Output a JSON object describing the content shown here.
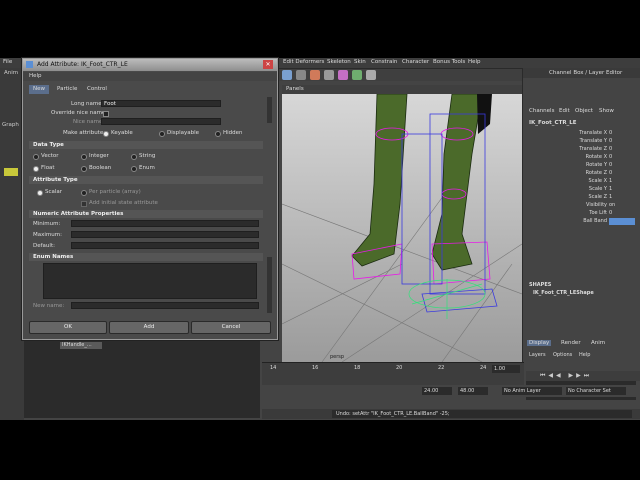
{
  "menubar": {
    "file": "File",
    "items": [
      "Edit Deformers",
      "Skeleton",
      "Skin",
      "Constrain",
      "Character",
      "Bonus Tools",
      "Help"
    ]
  },
  "left_panel": {
    "anim": "Anim",
    "graph": "Graph"
  },
  "viewport": {
    "panels": "Panels",
    "camera_label": "persp"
  },
  "timeline": {
    "ticks": [
      "14",
      "16",
      "18",
      "20",
      "22",
      "24"
    ],
    "current": "1.00"
  },
  "range": {
    "start": "24.00",
    "end": "48.00",
    "anim_layer": "No Anim Layer",
    "char_set": "No Character Set"
  },
  "command": {
    "text": "Undo: setAttr \"IK_Foot_CTR_LE.BallBand\" -25;"
  },
  "channel_box": {
    "header": "Channel Box / Layer Editor",
    "menu": [
      "Channels",
      "Edit",
      "Object",
      "Show"
    ],
    "node": "IK_Foot_CTR_LE",
    "attributes": [
      {
        "name": "Translate X",
        "value": "0"
      },
      {
        "name": "Translate Y",
        "value": "0"
      },
      {
        "name": "Translate Z",
        "value": "0"
      },
      {
        "name": "Rotate X",
        "value": "0"
      },
      {
        "name": "Rotate Y",
        "value": "0"
      },
      {
        "name": "Rotate Z",
        "value": "0"
      },
      {
        "name": "Scale X",
        "value": "1"
      },
      {
        "name": "Scale Y",
        "value": "1"
      },
      {
        "name": "Scale Z",
        "value": "1"
      },
      {
        "name": "Visibility",
        "value": "on"
      },
      {
        "name": "Toe Lift",
        "value": "0"
      },
      {
        "name": "Ball Band",
        "value": ""
      }
    ],
    "shapes_title": "SHAPES",
    "shape_node": "IK_Foot_CTR_LEShape",
    "tabs": [
      "Display",
      "Render",
      "Anim"
    ],
    "layer_menu": [
      "Layers",
      "Options",
      "Help"
    ]
  },
  "outliner": {
    "item": "IKHandle_..."
  },
  "dialog": {
    "title": "Add Attribute: IK_Foot_CTR_LE",
    "help": "Help",
    "tabs": [
      "New",
      "Particle",
      "Control"
    ],
    "long_name_label": "Long name:",
    "long_name_value": "Foot",
    "override_label": "Override nice name:",
    "nice_name_label": "Nice name:",
    "make_attr_label": "Make attribute:",
    "make_attr_options": [
      "Keyable",
      "Displayable",
      "Hidden"
    ],
    "data_type_title": "Data Type",
    "data_types": [
      "Vector",
      "Integer",
      "String",
      "Float",
      "Boolean",
      "Enum"
    ],
    "attr_type_title": "Attribute Type",
    "attr_types": [
      "Scalar",
      "Per particle (array)"
    ],
    "initial_state": "Add initial state attribute",
    "numeric_title": "Numeric Attribute Properties",
    "minimum": "Minimum:",
    "maximum": "Maximum:",
    "default": "Default:",
    "enum_title": "Enum Names",
    "new_name": "New name:",
    "ok": "OK",
    "add": "Add",
    "cancel": "Cancel"
  },
  "colors": {
    "accent": "#5b8fd4",
    "rig_magenta": "#e81ae8",
    "rig_blue": "#3a3adf",
    "leg_green": "#4b6a2a"
  }
}
